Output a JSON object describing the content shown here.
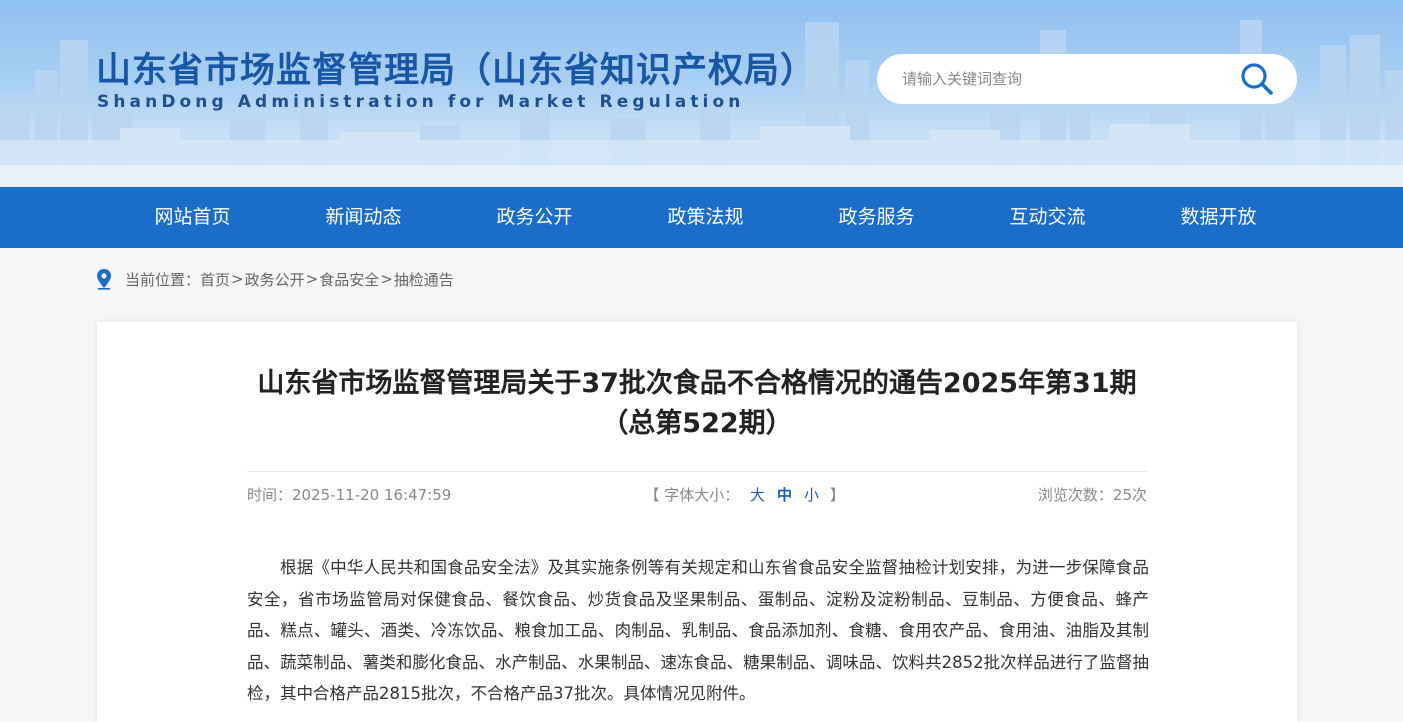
{
  "header": {
    "title": "山东省市场监督管理局（山东省知识产权局）",
    "subtitle": "ShanDong Administration for Market Regulation",
    "search": {
      "placeholder": "请输入关键词查询",
      "value": "",
      "icon": "search-icon"
    }
  },
  "nav": {
    "items": [
      {
        "label": "网站首页"
      },
      {
        "label": "新闻动态"
      },
      {
        "label": "政务公开"
      },
      {
        "label": "政策法规"
      },
      {
        "label": "政务服务"
      },
      {
        "label": "互动交流"
      },
      {
        "label": "数据开放"
      }
    ]
  },
  "breadcrumb": {
    "icon": "location-pin-icon",
    "prefix": "当前位置：",
    "items": [
      "首页",
      "政务公开",
      "食品安全",
      "抽检通告"
    ],
    "separator": ">"
  },
  "article": {
    "title": "山东省市场监督管理局关于37批次食品不合格情况的通告2025年第31期（总第522期）",
    "time_label": "时间：",
    "time": "2025-11-20 16:47:59",
    "font_size": {
      "open": "【",
      "label": "字体大小：",
      "large": "大",
      "medium": "中",
      "small": "小",
      "close": "】"
    },
    "views_label": "浏览次数：",
    "views": "25次",
    "body": "根据《中华人民共和国食品安全法》及其实施条例等有关规定和山东省食品安全监督抽检计划安排，为进一步保障食品安全，省市场监管局对保健食品、餐饮食品、炒货食品及坚果制品、蛋制品、淀粉及淀粉制品、豆制品、方便食品、蜂产品、糕点、罐头、酒类、冷冻饮品、粮食加工品、肉制品、乳制品、食品添加剂、食糖、食用农产品、食用油、油脂及其制品、蔬菜制品、薯类和膨化食品、水产制品、水果制品、速冻食品、糖果制品、调味品、饮料共2852批次样品进行了监督抽检，其中合格产品2815批次，不合格产品37批次。具体情况见附件。"
  },
  "colors": {
    "nav_bg": "#1a6dc8",
    "title_blue": "#1957a6",
    "link_blue": "#1a5fae"
  }
}
